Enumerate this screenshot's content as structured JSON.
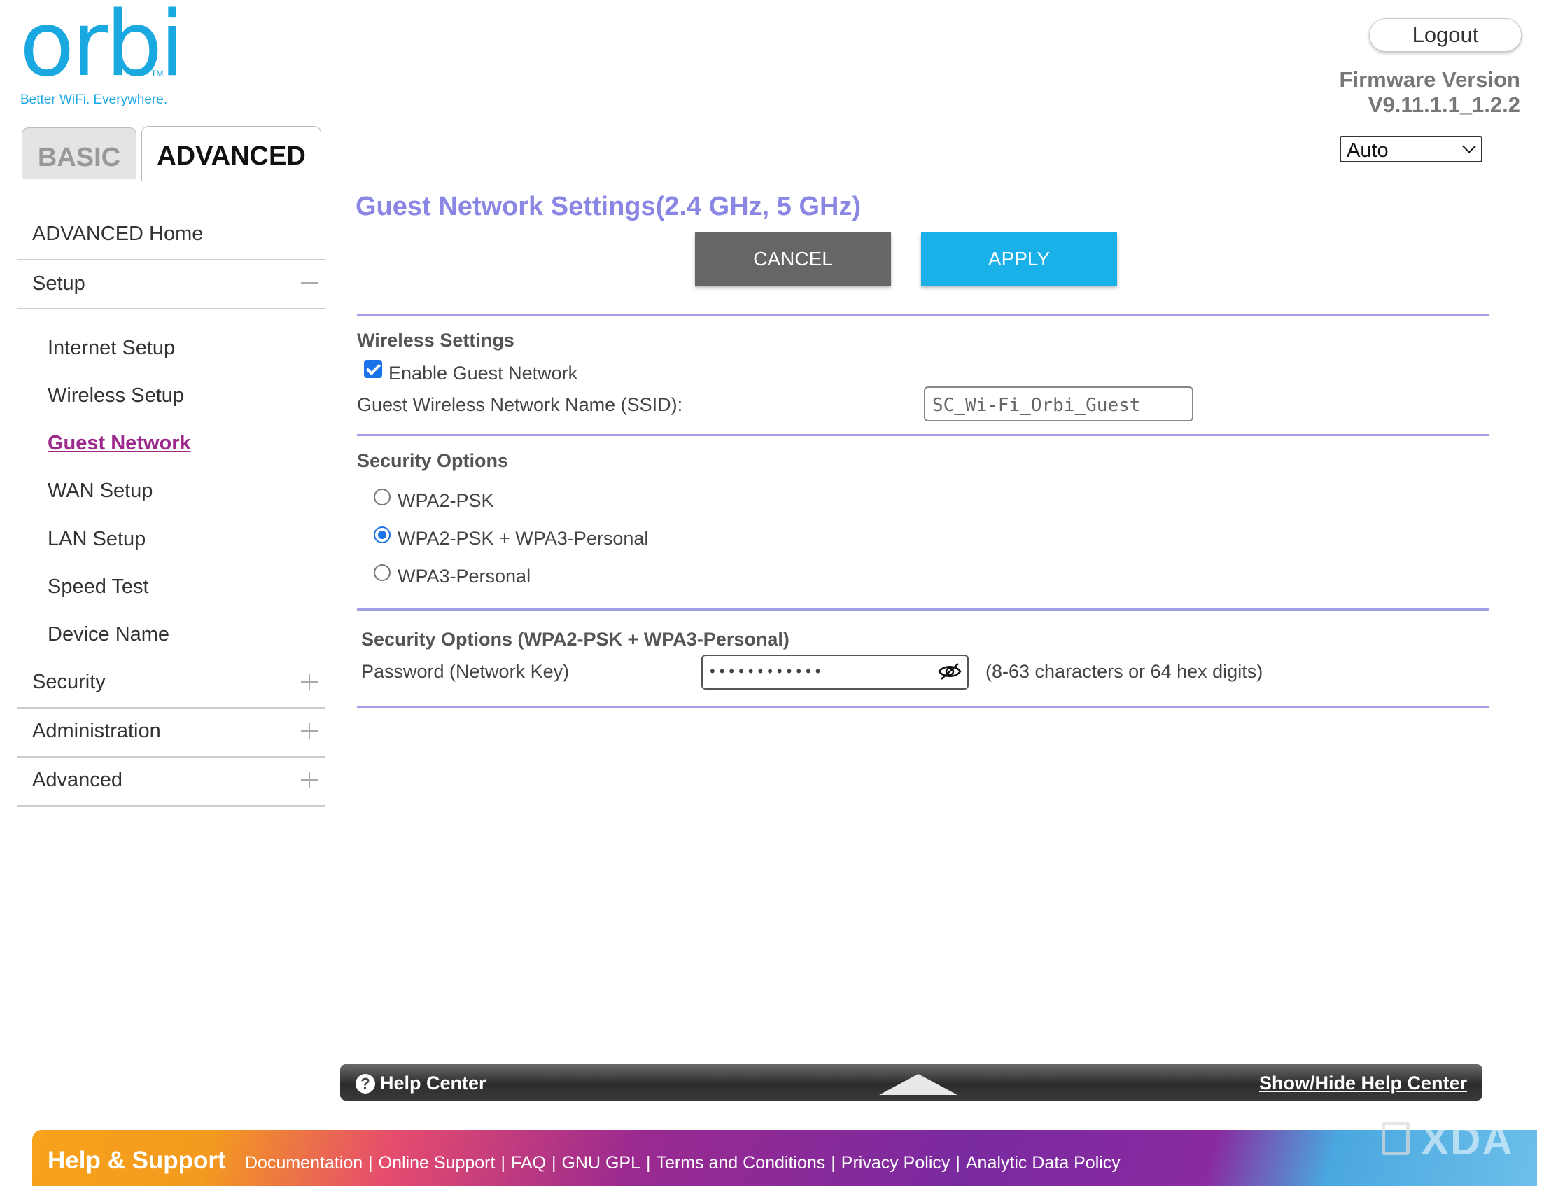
{
  "header": {
    "logo_text": "orbi",
    "logo_tm": "TM",
    "tagline": "Better WiFi. Everywhere.",
    "logout_label": "Logout",
    "firmware_label": "Firmware Version",
    "firmware_value": "V9.11.1.1_1.2.2",
    "language_selected": "Auto"
  },
  "tabs": [
    {
      "label": "BASIC",
      "active": false
    },
    {
      "label": "ADVANCED",
      "active": true
    }
  ],
  "sidebar": {
    "home": "ADVANCED Home",
    "setup": "Setup",
    "setup_items": [
      "Internet Setup",
      "Wireless Setup",
      "Guest Network",
      "WAN Setup",
      "LAN Setup",
      "Speed Test",
      "Device Name"
    ],
    "active_item": "Guest Network",
    "security": "Security",
    "administration": "Administration",
    "advanced": "Advanced"
  },
  "main": {
    "title": "Guest Network Settings(2.4 GHz, 5 GHz)",
    "cancel_label": "CANCEL",
    "apply_label": "APPLY",
    "wireless_settings_title": "Wireless Settings",
    "enable_guest_label": "Enable Guest Network",
    "enable_guest_checked": true,
    "ssid_label": "Guest Wireless Network Name (SSID):",
    "ssid_value": "SC_Wi-Fi_Orbi_Guest",
    "security_options_title": "Security Options",
    "security_options": [
      {
        "label": "WPA2-PSK",
        "selected": false
      },
      {
        "label": "WPA2-PSK + WPA3-Personal",
        "selected": true
      },
      {
        "label": "WPA3-Personal",
        "selected": false
      }
    ],
    "security_detail_title": "Security Options (WPA2-PSK + WPA3-Personal)",
    "password_label": "Password (Network Key)",
    "password_masked": "••••••••••••",
    "password_hint": "(8-63 characters or 64 hex digits)"
  },
  "help_center": {
    "title": "Help Center",
    "toggle_label": "Show/Hide Help Center"
  },
  "footer": {
    "title": "Help & Support",
    "links": [
      "Documentation",
      "Online Support",
      "FAQ",
      "GNU GPL",
      "Terms and Conditions",
      "Privacy Policy",
      "Analytic Data Policy"
    ]
  },
  "watermark": "XDA",
  "colors": {
    "brand_blue": "#1aa8e0",
    "title_purple": "#8a86e4",
    "active_link": "#9b2a8c",
    "apply_blue": "#1ab0e8",
    "cancel_gray": "#666666"
  }
}
